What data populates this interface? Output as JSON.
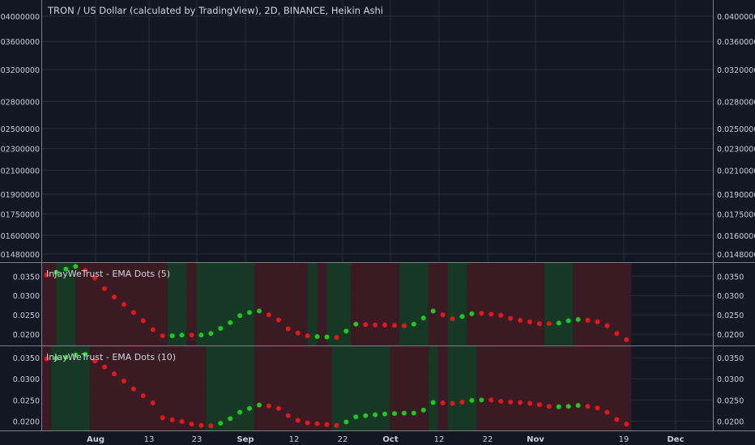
{
  "title": "TRON / US Dollar (calculated by TradingView), 2D, BINANCE, Heikin Ashi",
  "colors": {
    "background": "#131722",
    "grid": "#2a2e39",
    "text": "#d1d4dc",
    "axisText": "#c8cbd3",
    "separator": "#7c808a",
    "redDot": "#e0191c",
    "greenDot": "#1ec81e",
    "redBand": "#3c1a24",
    "greenBand": "#163a25"
  },
  "x_labels": [
    "Aug",
    "13",
    "23",
    "Sep",
    "12",
    "22",
    "Oct",
    "12",
    "22",
    "Nov",
    "19",
    "Dec"
  ],
  "x_label_bold": [
    "Aug",
    "Sep",
    "Oct",
    "Nov",
    "Dec"
  ],
  "chart_data": [
    {
      "type": "line",
      "name": "price-pane",
      "scale": "log",
      "title": "TRON / US Dollar (calculated by TradingView), 2D, BINANCE, Heikin Ashi",
      "y_ticks": [
        "0.04000000",
        "0.03600000",
        "0.03200000",
        "0.02800000",
        "0.02500000",
        "0.02300000",
        "0.02100000",
        "0.01900000",
        "0.01750000",
        "0.01600000",
        "0.01480000"
      ],
      "y_tick_values": [
        0.04,
        0.036,
        0.032,
        0.028,
        0.025,
        0.023,
        0.021,
        0.019,
        0.0175,
        0.016,
        0.0148
      ],
      "ylim": [
        0.0143,
        0.0428
      ],
      "grid": true,
      "series": []
    },
    {
      "type": "scatter",
      "title": "InJayWeTrust - EMA Dots (5)",
      "y_ticks": [
        "0.0350",
        "0.0300",
        "0.0250",
        "0.0200"
      ],
      "y_tick_values": [
        0.035,
        0.03,
        0.025,
        0.02
      ],
      "ylim": [
        0.0171,
        0.0384
      ],
      "x_bar_index": [
        0,
        1,
        2,
        3,
        4,
        5,
        6,
        7,
        8,
        9,
        10,
        11,
        12,
        13,
        14,
        15,
        16,
        17,
        18,
        19,
        20,
        21,
        22,
        23,
        24,
        25,
        26,
        27,
        28,
        29,
        30,
        31,
        32,
        33,
        34,
        35,
        36,
        37,
        38,
        39,
        40,
        41,
        42,
        43,
        44,
        45,
        46,
        47,
        48,
        49,
        50,
        51,
        52,
        53,
        54,
        55,
        56,
        57,
        58,
        59,
        60
      ],
      "values": [
        0.0353,
        0.036,
        0.0368,
        0.0375,
        0.0365,
        0.0345,
        0.0318,
        0.0296,
        0.0277,
        0.0256,
        0.0235,
        0.0212,
        0.0196,
        0.0196,
        0.0198,
        0.0198,
        0.0198,
        0.0202,
        0.0215,
        0.023,
        0.0248,
        0.0256,
        0.026,
        0.025,
        0.0237,
        0.0214,
        0.0203,
        0.0196,
        0.0194,
        0.0193,
        0.0192,
        0.0208,
        0.0226,
        0.0225,
        0.0224,
        0.0224,
        0.0223,
        0.0222,
        0.0226,
        0.0242,
        0.026,
        0.025,
        0.024,
        0.0246,
        0.0253,
        0.0254,
        0.0252,
        0.0249,
        0.0241,
        0.0236,
        0.0232,
        0.0227,
        0.0227,
        0.0229,
        0.0235,
        0.0238,
        0.0236,
        0.0232,
        0.0222,
        0.0202,
        0.0186
      ],
      "colors": [
        "r",
        "g",
        "g",
        "g",
        "r",
        "r",
        "r",
        "r",
        "r",
        "r",
        "r",
        "r",
        "r",
        "g",
        "g",
        "r",
        "g",
        "g",
        "g",
        "g",
        "g",
        "g",
        "g",
        "r",
        "r",
        "r",
        "r",
        "r",
        "g",
        "g",
        "r",
        "g",
        "g",
        "r",
        "r",
        "r",
        "r",
        "r",
        "g",
        "g",
        "g",
        "r",
        "r",
        "g",
        "g",
        "r",
        "r",
        "r",
        "r",
        "r",
        "r",
        "r",
        "r",
        "g",
        "g",
        "g",
        "r",
        "r",
        "r",
        "r",
        "r"
      ],
      "bands": [
        {
          "from": 0,
          "to": 1,
          "color": "r"
        },
        {
          "from": 1,
          "to": 3,
          "color": "g"
        },
        {
          "from": 3,
          "to": 12.5,
          "color": "r"
        },
        {
          "from": 12.5,
          "to": 14.5,
          "color": "g"
        },
        {
          "from": 14.5,
          "to": 15.5,
          "color": "r"
        },
        {
          "from": 15.5,
          "to": 21.5,
          "color": "g"
        },
        {
          "from": 21.5,
          "to": 27,
          "color": "r"
        },
        {
          "from": 27,
          "to": 28,
          "color": "g"
        },
        {
          "from": 28,
          "to": 29,
          "color": "r"
        },
        {
          "from": 29,
          "to": 31.5,
          "color": "g"
        },
        {
          "from": 31.5,
          "to": 36.5,
          "color": "r"
        },
        {
          "from": 36.5,
          "to": 39.5,
          "color": "g"
        },
        {
          "from": 39.5,
          "to": 41.5,
          "color": "r"
        },
        {
          "from": 41.5,
          "to": 43.5,
          "color": "g"
        },
        {
          "from": 43.5,
          "to": 51.5,
          "color": "r"
        },
        {
          "from": 51.5,
          "to": 54.5,
          "color": "g"
        },
        {
          "from": 54.5,
          "to": 60.5,
          "color": "r"
        }
      ]
    },
    {
      "type": "scatter",
      "title": "InJayWeTrust - EMA Dots (10)",
      "y_ticks": [
        "0.0350",
        "0.0300",
        "0.0250",
        "0.0200"
      ],
      "y_tick_values": [
        0.035,
        0.03,
        0.025,
        0.02
      ],
      "ylim": [
        0.0178,
        0.0377
      ],
      "x_bar_index": [
        0,
        1,
        2,
        3,
        4,
        5,
        6,
        7,
        8,
        9,
        10,
        11,
        12,
        13,
        14,
        15,
        16,
        17,
        18,
        19,
        20,
        21,
        22,
        23,
        24,
        25,
        26,
        27,
        28,
        29,
        30,
        31,
        32,
        33,
        34,
        35,
        36,
        37,
        38,
        39,
        40,
        41,
        42,
        43,
        44,
        45,
        46,
        47,
        48,
        49,
        50,
        51,
        52,
        53,
        54,
        55,
        56,
        57,
        58,
        59,
        60
      ],
      "values": [
        0.0347,
        0.0349,
        0.0351,
        0.0357,
        0.0358,
        0.0342,
        0.0328,
        0.0312,
        0.0295,
        0.0276,
        0.026,
        0.0243,
        0.0208,
        0.0203,
        0.0199,
        0.0193,
        0.019,
        0.0189,
        0.0195,
        0.0206,
        0.0221,
        0.023,
        0.0238,
        0.0236,
        0.023,
        0.0213,
        0.0202,
        0.0196,
        0.0194,
        0.0192,
        0.019,
        0.0198,
        0.021,
        0.0213,
        0.0215,
        0.0217,
        0.0218,
        0.0219,
        0.0219,
        0.0226,
        0.0244,
        0.0243,
        0.0242,
        0.0245,
        0.0249,
        0.025,
        0.025,
        0.0247,
        0.0245,
        0.0244,
        0.0242,
        0.0239,
        0.0235,
        0.0234,
        0.0235,
        0.0237,
        0.0235,
        0.0231,
        0.0221,
        0.0204,
        0.0193
      ],
      "colors": [
        "r",
        "g",
        "g",
        "g",
        "g",
        "r",
        "r",
        "r",
        "r",
        "r",
        "r",
        "r",
        "r",
        "r",
        "r",
        "r",
        "r",
        "r",
        "g",
        "g",
        "g",
        "g",
        "g",
        "r",
        "r",
        "r",
        "r",
        "r",
        "r",
        "r",
        "r",
        "g",
        "g",
        "g",
        "g",
        "g",
        "g",
        "g",
        "g",
        "g",
        "g",
        "r",
        "r",
        "r",
        "g",
        "g",
        "r",
        "r",
        "r",
        "r",
        "r",
        "r",
        "r",
        "g",
        "g",
        "g",
        "r",
        "r",
        "r",
        "r",
        "r"
      ],
      "bands": [
        {
          "from": 0,
          "to": 0.5,
          "color": "r"
        },
        {
          "from": 0.5,
          "to": 4.5,
          "color": "g"
        },
        {
          "from": 4.5,
          "to": 16.5,
          "color": "r"
        },
        {
          "from": 16.5,
          "to": 21.5,
          "color": "g"
        },
        {
          "from": 21.5,
          "to": 29.5,
          "color": "r"
        },
        {
          "from": 29.5,
          "to": 35.5,
          "color": "g"
        },
        {
          "from": 35.5,
          "to": 39.5,
          "color": "r"
        },
        {
          "from": 39.5,
          "to": 40.5,
          "color": "g"
        },
        {
          "from": 40.5,
          "to": 41.5,
          "color": "r"
        },
        {
          "from": 41.5,
          "to": 44.5,
          "color": "g"
        },
        {
          "from": 44.5,
          "to": 60.5,
          "color": "r"
        }
      ]
    }
  ]
}
